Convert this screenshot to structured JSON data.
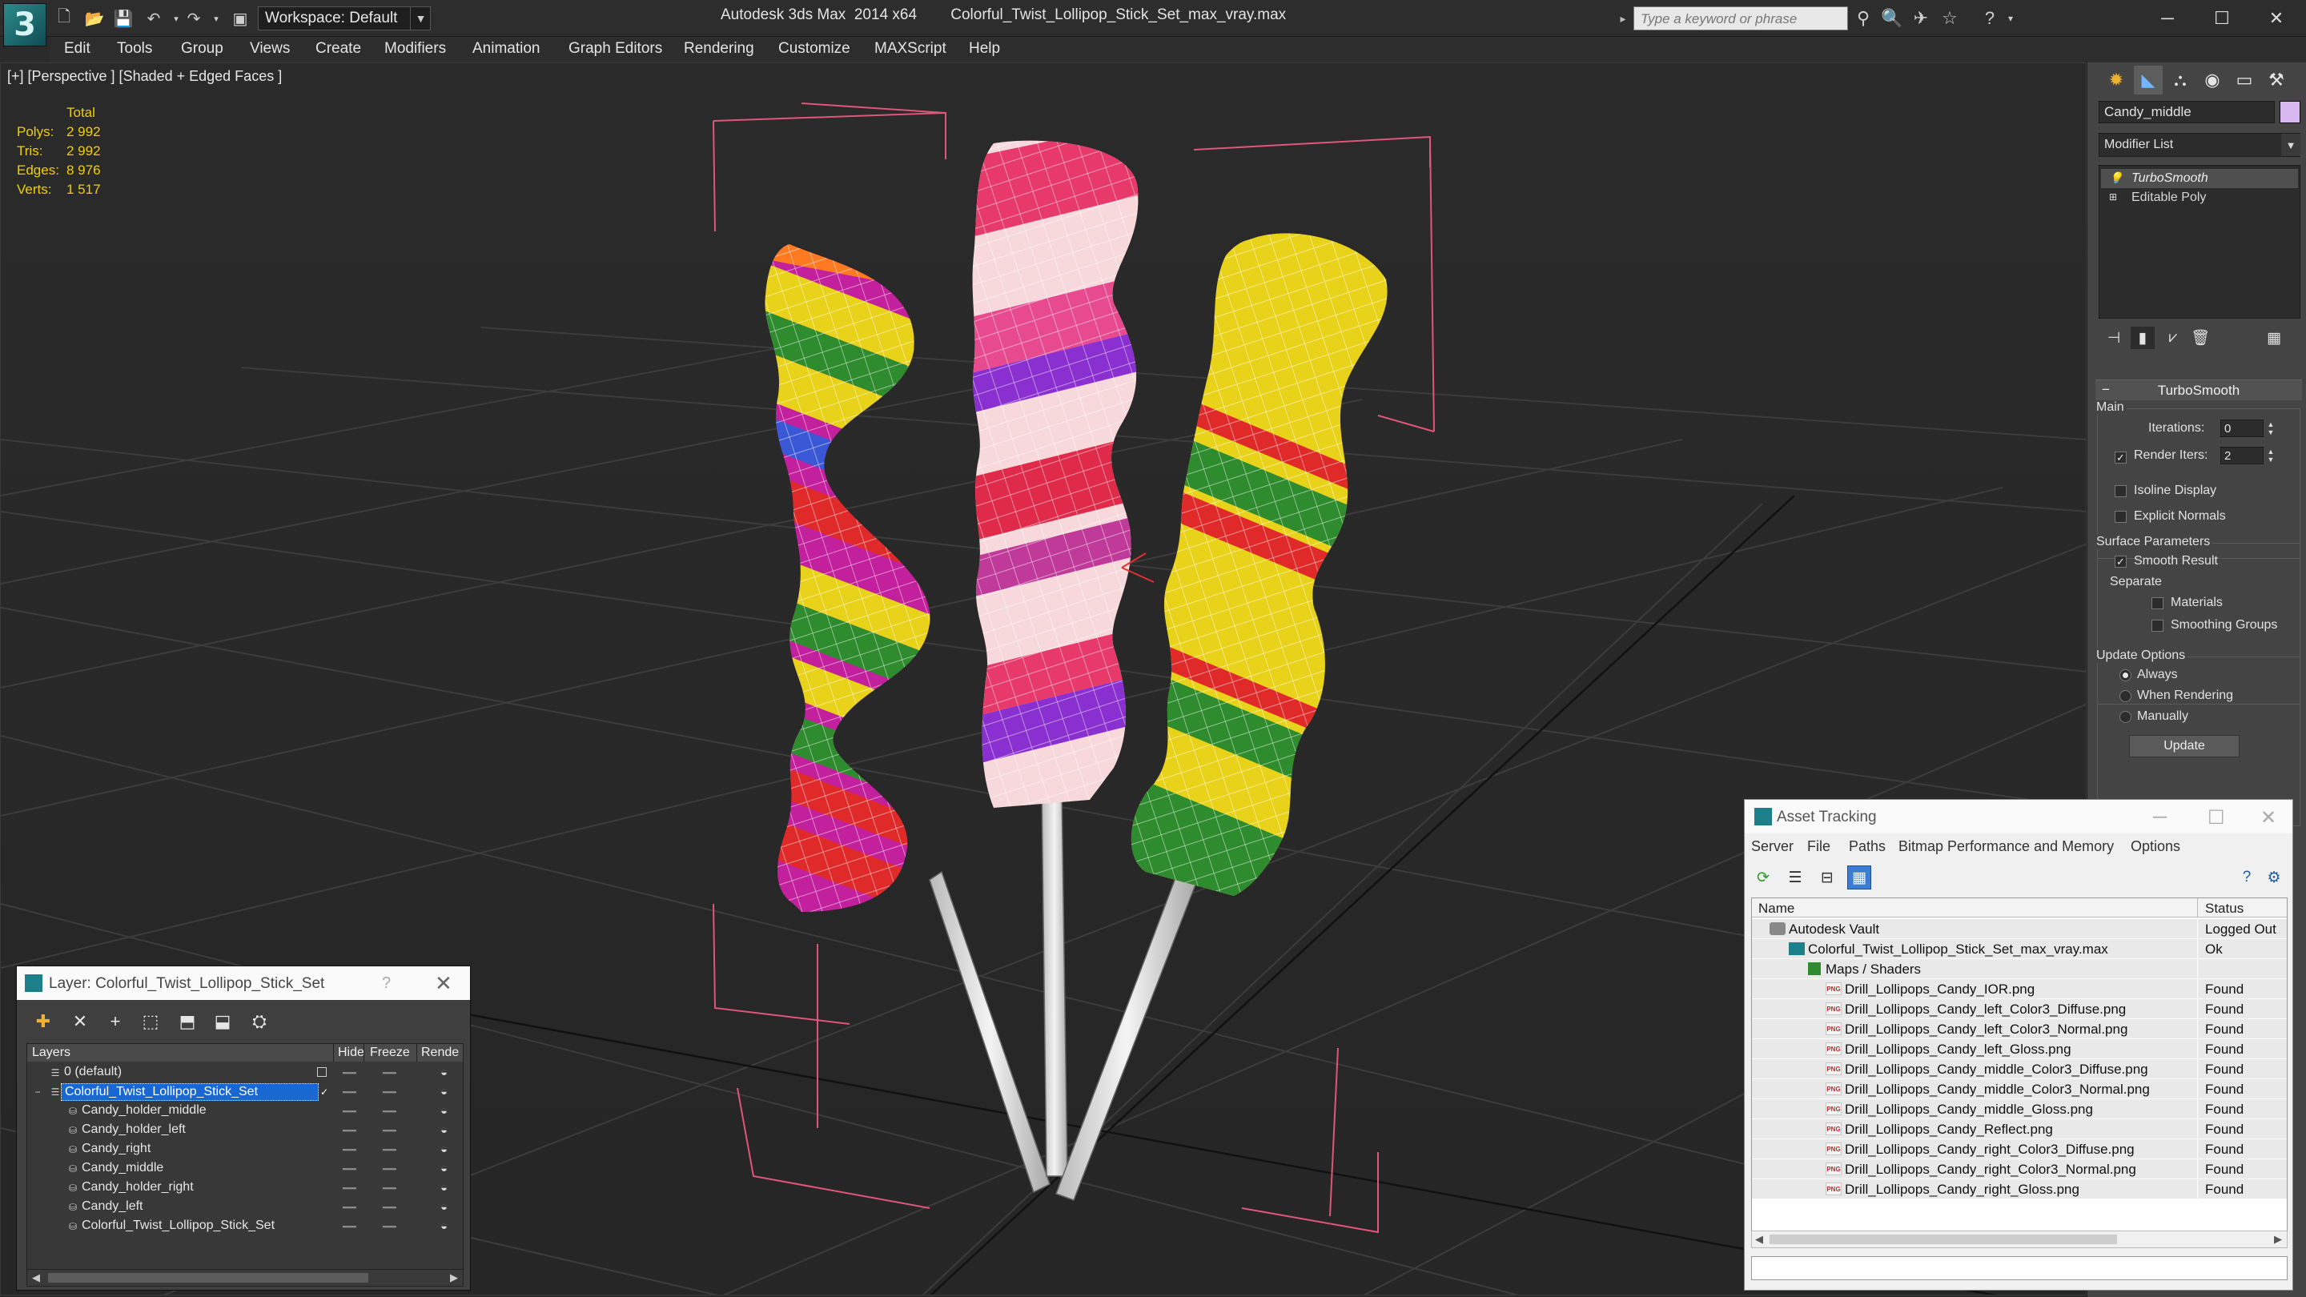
{
  "titlebar": {
    "title": "Autodesk 3ds Max  2014 x64        Colorful_Twist_Lollipop_Stick_Set_max_vray.max",
    "workspace": "Workspace: Default",
    "search_placeholder": "Type a keyword or phrase"
  },
  "menu": [
    "Edit",
    "Tools",
    "Group",
    "Views",
    "Create",
    "Modifiers",
    "Animation",
    "Graph Editors",
    "Rendering",
    "Customize",
    "MAXScript",
    "Help"
  ],
  "viewport": {
    "label": "[+] [Perspective ] [Shaded + Edged Faces ]",
    "stats": {
      "header": "Total",
      "rows": [
        {
          "k": "Polys:",
          "v": "2 992"
        },
        {
          "k": "Tris:",
          "v": "2 992"
        },
        {
          "k": "Edges:",
          "v": "8 976"
        },
        {
          "k": "Verts:",
          "v": "1 517"
        }
      ]
    }
  },
  "command_panel": {
    "object_name": "Candy_middle",
    "object_color": "#d9b7f0",
    "modifier_list": "Modifier List",
    "stack": [
      "TurboSmooth",
      "Editable Poly"
    ],
    "rollout": "TurboSmooth",
    "main_group": "Main",
    "iterations_label": "Iterations:",
    "iterations_value": "0",
    "render_iters_label": "Render Iters:",
    "render_iters_value": "2",
    "isoline": "Isoline Display",
    "explicit_normals": "Explicit Normals",
    "surface_group": "Surface Parameters",
    "smooth_result": "Smooth Result",
    "separate": "Separate",
    "materials": "Materials",
    "smoothing_groups": "Smoothing Groups",
    "update_group": "Update Options",
    "always": "Always",
    "when_rendering": "When Rendering",
    "manually": "Manually",
    "update_button": "Update"
  },
  "layer_dialog": {
    "title": "Layer: Colorful_Twist_Lollipop_Stick_Set",
    "help": "?",
    "columns": {
      "layers": "Layers",
      "hide": "Hide",
      "freeze": "Freeze",
      "render": "Rende"
    },
    "rows": [
      {
        "name": "0 (default)"
      },
      {
        "name": "Colorful_Twist_Lollipop_Stick_Set"
      },
      {
        "name": "Candy_holder_middle"
      },
      {
        "name": "Candy_holder_left"
      },
      {
        "name": "Candy_right"
      },
      {
        "name": "Candy_middle"
      },
      {
        "name": "Candy_holder_right"
      },
      {
        "name": "Candy_left"
      },
      {
        "name": "Colorful_Twist_Lollipop_Stick_Set"
      }
    ]
  },
  "asset_tracking": {
    "title": "Asset Tracking",
    "menu": [
      "Server",
      "File",
      "Paths",
      "Bitmap Performance and Memory",
      "Options"
    ],
    "columns": {
      "name": "Name",
      "status": "Status"
    },
    "rows": [
      {
        "name": "Autodesk Vault",
        "status": "Logged Out",
        "icon": "vault"
      },
      {
        "name": "Colorful_Twist_Lollipop_Stick_Set_max_vray.max",
        "status": "Ok",
        "icon": "max"
      },
      {
        "name": "Maps / Shaders",
        "status": "",
        "icon": "maps"
      },
      {
        "name": "Drill_Lollipops_Candy_IOR.png",
        "status": "Found",
        "icon": "png"
      },
      {
        "name": "Drill_Lollipops_Candy_left_Color3_Diffuse.png",
        "status": "Found",
        "icon": "png"
      },
      {
        "name": "Drill_Lollipops_Candy_left_Color3_Normal.png",
        "status": "Found",
        "icon": "png"
      },
      {
        "name": "Drill_Lollipops_Candy_left_Gloss.png",
        "status": "Found",
        "icon": "png"
      },
      {
        "name": "Drill_Lollipops_Candy_middle_Color3_Diffuse.png",
        "status": "Found",
        "icon": "png"
      },
      {
        "name": "Drill_Lollipops_Candy_middle_Color3_Normal.png",
        "status": "Found",
        "icon": "png"
      },
      {
        "name": "Drill_Lollipops_Candy_middle_Gloss.png",
        "status": "Found",
        "icon": "png"
      },
      {
        "name": "Drill_Lollipops_Candy_Reflect.png",
        "status": "Found",
        "icon": "png"
      },
      {
        "name": "Drill_Lollipops_Candy_right_Color3_Diffuse.png",
        "status": "Found",
        "icon": "png"
      },
      {
        "name": "Drill_Lollipops_Candy_right_Color3_Normal.png",
        "status": "Found",
        "icon": "png"
      },
      {
        "name": "Drill_Lollipops_Candy_right_Gloss.png",
        "status": "Found",
        "icon": "png"
      }
    ]
  }
}
